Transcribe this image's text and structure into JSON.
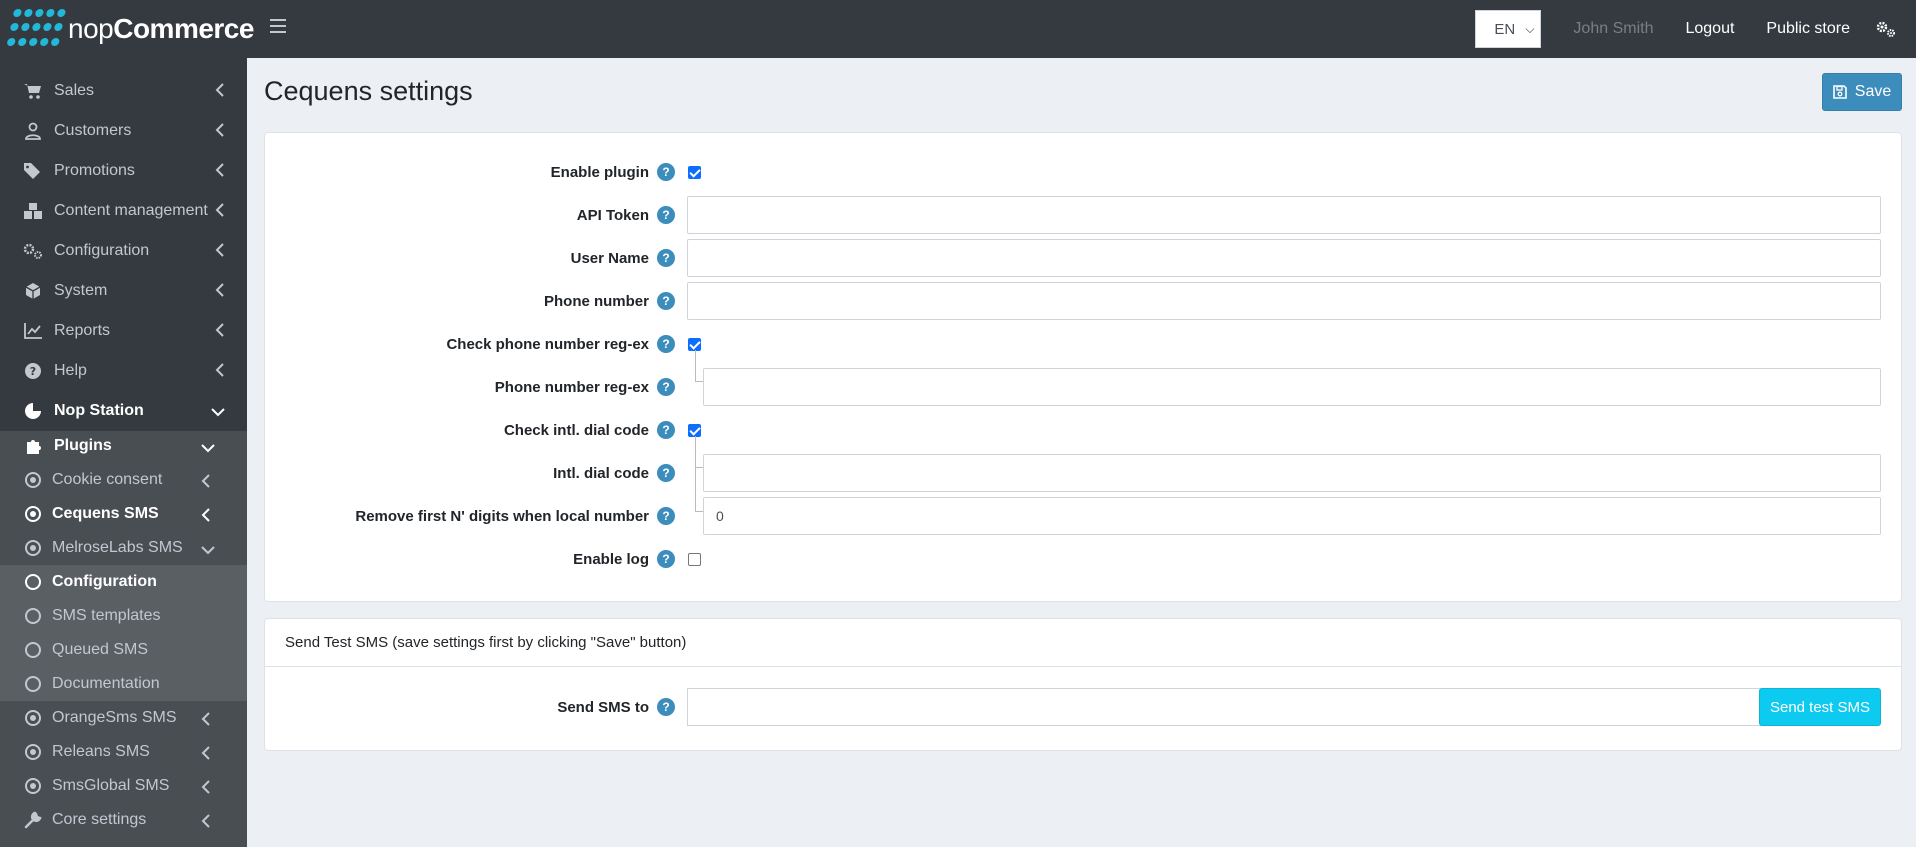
{
  "brand": {
    "name_prefix": "nop",
    "name_suffix": "Commerce"
  },
  "topnav": {
    "language": "EN",
    "user": "John Smith",
    "logout": "Logout",
    "public_store": "Public store"
  },
  "sidebar": {
    "items": [
      {
        "label": "Sales",
        "icon": "cart-icon"
      },
      {
        "label": "Customers",
        "icon": "user-icon"
      },
      {
        "label": "Promotions",
        "icon": "tags-icon"
      },
      {
        "label": "Content management",
        "icon": "cubes-icon"
      },
      {
        "label": "Configuration",
        "icon": "gears-icon"
      },
      {
        "label": "System",
        "icon": "cube-icon"
      },
      {
        "label": "Reports",
        "icon": "chart-line-icon"
      },
      {
        "label": "Help",
        "icon": "question-circle-icon"
      },
      {
        "label": "Nop Station",
        "icon": "circle-icon"
      },
      {
        "label": "Plugins",
        "icon": "puzzle-icon"
      },
      {
        "label": "Cookie consent",
        "icon": "dot-circle-icon"
      },
      {
        "label": "Cequens SMS",
        "icon": "dot-circle-icon"
      },
      {
        "label": "MelroseLabs SMS",
        "icon": "dot-circle-icon"
      },
      {
        "label": "Configuration",
        "icon": "circle-outline-icon"
      },
      {
        "label": "SMS templates",
        "icon": "circle-outline-icon"
      },
      {
        "label": "Queued SMS",
        "icon": "circle-outline-icon"
      },
      {
        "label": "Documentation",
        "icon": "circle-outline-icon"
      },
      {
        "label": "OrangeSms SMS",
        "icon": "dot-circle-icon"
      },
      {
        "label": "Releans SMS",
        "icon": "dot-circle-icon"
      },
      {
        "label": "SmsGlobal SMS",
        "icon": "dot-circle-icon"
      },
      {
        "label": "Core settings",
        "icon": "wrench-icon"
      }
    ]
  },
  "page": {
    "title": "Cequens settings",
    "save_label": "Save"
  },
  "form": {
    "enable_plugin": {
      "label": "Enable plugin",
      "checked": true
    },
    "api_token": {
      "label": "API Token",
      "value": ""
    },
    "user_name": {
      "label": "User Name",
      "value": ""
    },
    "phone_number": {
      "label": "Phone number",
      "value": ""
    },
    "check_regex": {
      "label": "Check phone number reg-ex",
      "checked": true
    },
    "phone_regex": {
      "label": "Phone number reg-ex",
      "value": ""
    },
    "check_dial_code": {
      "label": "Check intl. dial code",
      "checked": true
    },
    "dial_code": {
      "label": "Intl. dial code",
      "value": ""
    },
    "remove_digits": {
      "label": "Remove first N' digits when local number",
      "value": "0"
    },
    "enable_log": {
      "label": "Enable log",
      "checked": false
    }
  },
  "test_sms": {
    "header": "Send Test SMS (save settings first by clicking \"Save\" button)",
    "label": "Send SMS to",
    "button": "Send test SMS",
    "value": ""
  },
  "help_glyph": "?"
}
